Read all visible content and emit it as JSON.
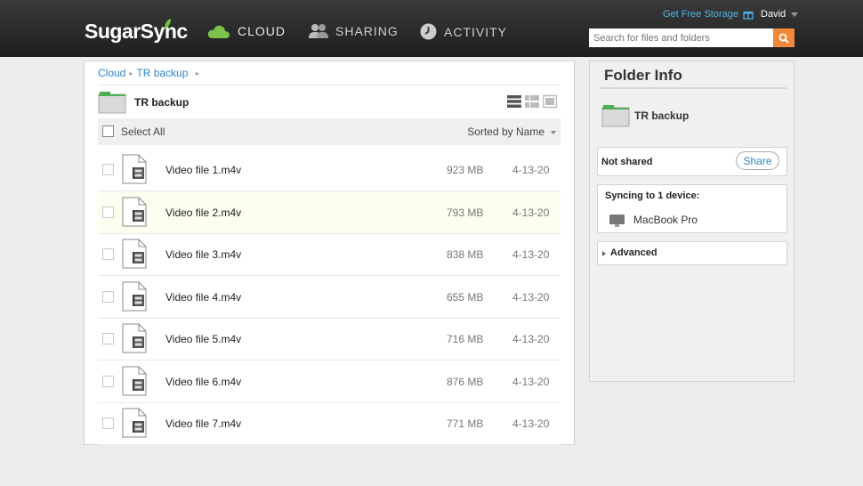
{
  "header": {
    "logo": "SugarSync",
    "nav": [
      {
        "label": "CLOUD",
        "icon": "cloud-icon"
      },
      {
        "label": "SHARING",
        "icon": "people-icon"
      },
      {
        "label": "ACTIVITY",
        "icon": "clock-icon"
      }
    ],
    "free_storage": "Get Free Storage",
    "user": "David",
    "search_placeholder": "Search for files and folders"
  },
  "breadcrumb": [
    "Cloud",
    "TR backup"
  ],
  "folder": {
    "name": "TR backup"
  },
  "toolbar": {
    "select_all": "Select All",
    "sort_label": "Sorted by Name"
  },
  "files": [
    {
      "name": "Video file 1.m4v",
      "size": "923 MB",
      "date": "4-13-20"
    },
    {
      "name": "Video file 2.m4v",
      "size": "793 MB",
      "date": "4-13-20"
    },
    {
      "name": "Video file 3.m4v",
      "size": "838 MB",
      "date": "4-13-20"
    },
    {
      "name": "Video file 4.m4v",
      "size": "655 MB",
      "date": "4-13-20"
    },
    {
      "name": "Video file 5.m4v",
      "size": "716 MB",
      "date": "4-13-20"
    },
    {
      "name": "Video file 6.m4v",
      "size": "876 MB",
      "date": "4-13-20"
    },
    {
      "name": "Video file 7.m4v",
      "size": "771 MB",
      "date": "4-13-20"
    }
  ],
  "info": {
    "title": "Folder Info",
    "folder_name": "TR backup",
    "share_status": "Not shared",
    "share_button": "Share",
    "sync_title": "Syncing to 1 device:",
    "device": "MacBook Pro",
    "advanced": "Advanced"
  },
  "colors": {
    "accent": "#2f86c4",
    "search_button": "#f0883a",
    "folder_green": "#4caf50",
    "header_bg": "#2a2a2a"
  }
}
